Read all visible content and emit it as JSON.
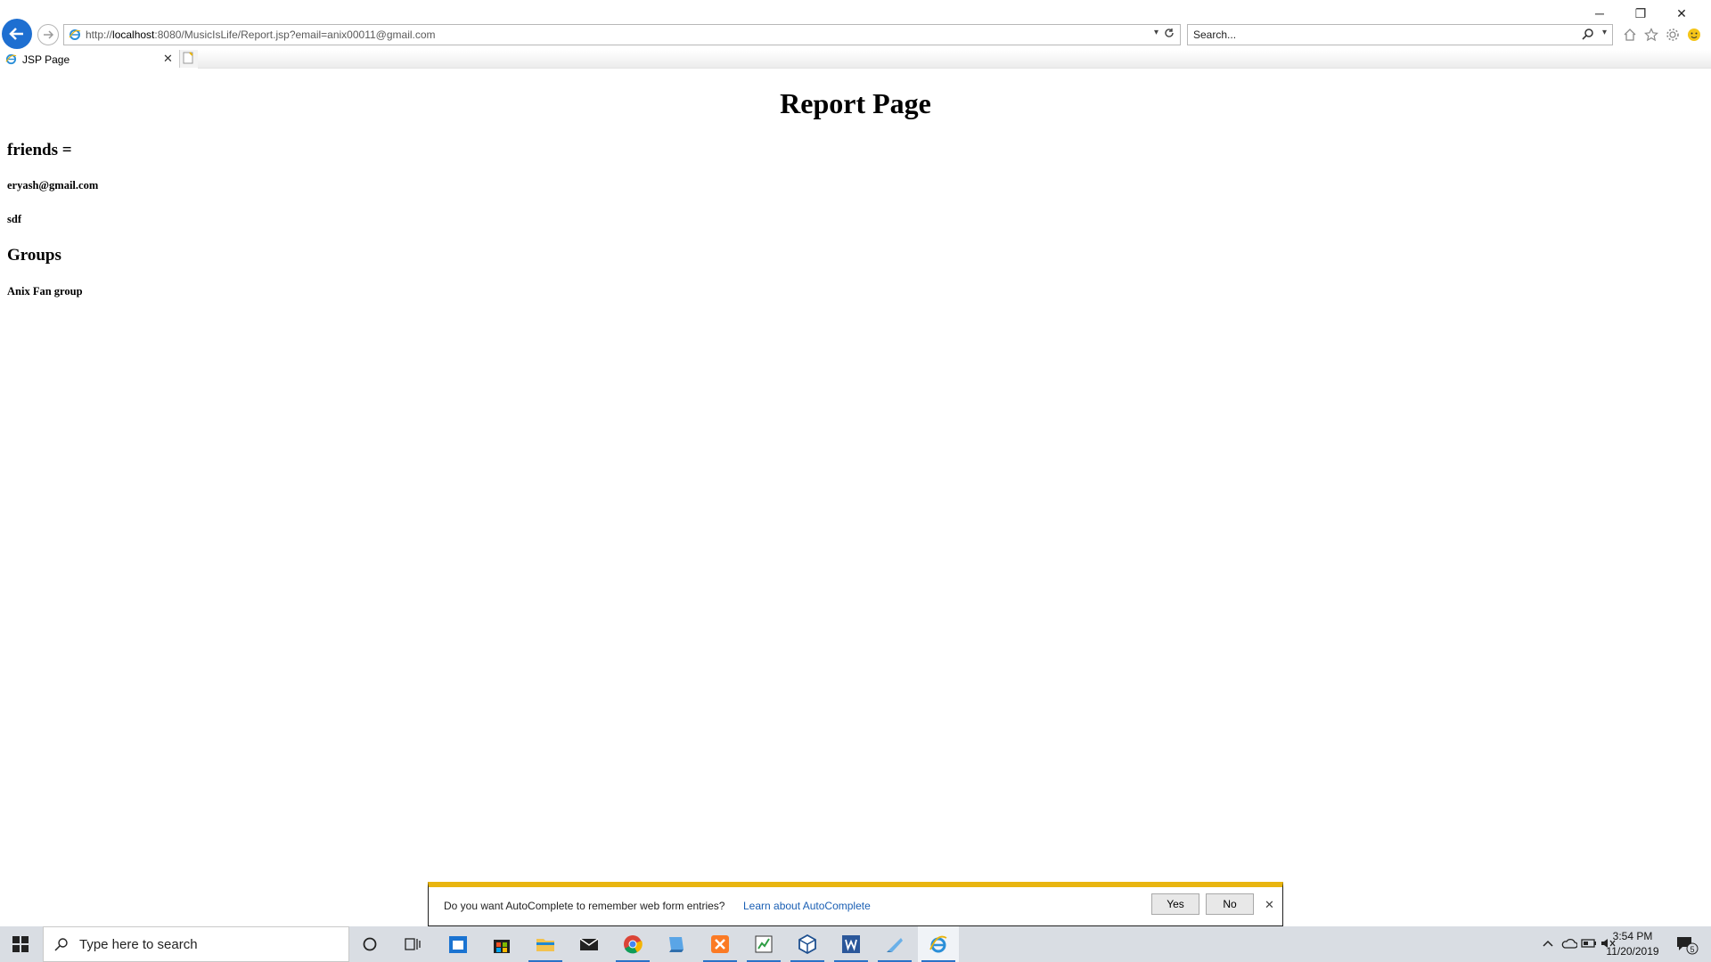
{
  "browser": {
    "url_prefix": "http://",
    "url_host": "localhost",
    "url_rest": ":8080/MusicIsLife/Report.jsp?email=anix00011@gmail.com",
    "search_placeholder": "Search...",
    "tab_title": "JSP Page"
  },
  "page": {
    "heading": "Report Page",
    "friends_heading": "friends =",
    "friends": [
      "eryash@gmail.com",
      "sdf"
    ],
    "groups_heading": "Groups",
    "groups": [
      "Anix Fan group"
    ]
  },
  "autocomplete": {
    "message": "Do you want AutoComplete to remember web form entries?",
    "learn_link": "Learn about AutoComplete",
    "yes_label": "Yes",
    "no_label": "No"
  },
  "taskbar": {
    "search_placeholder": "Type here to search",
    "time": "3:54 PM",
    "date": "11/20/2019",
    "notification_count": "5"
  },
  "colors": {
    "back_button": "#1e6fd1",
    "notification_bar": "#e9b50f",
    "link": "#1a5fb4"
  }
}
